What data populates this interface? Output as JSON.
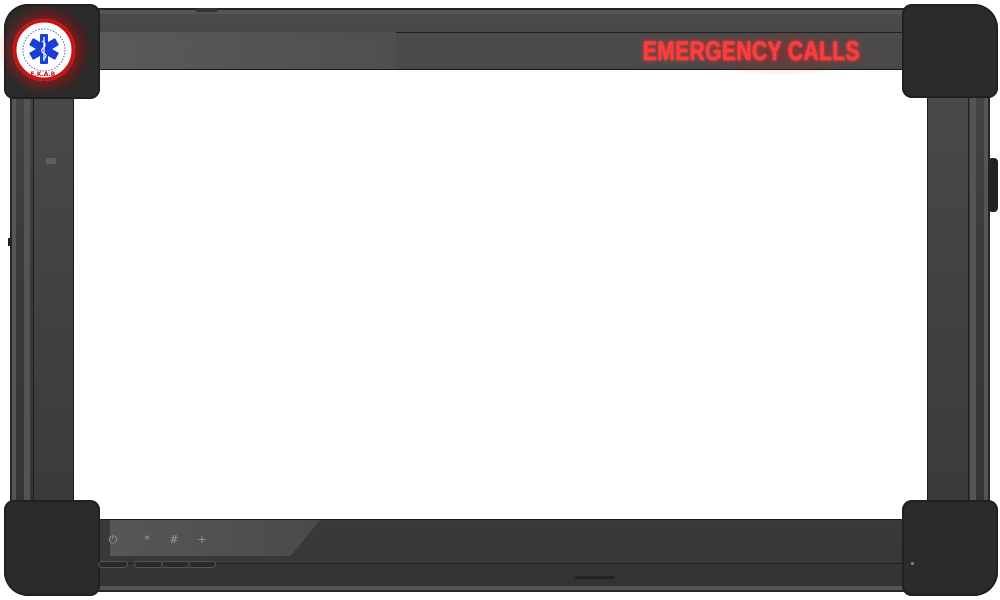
{
  "header": {
    "title": "EMERGENCY CALLS",
    "title_color": "#ff3b3b"
  },
  "logo": {
    "name": "ekab-star-of-life-logo",
    "ring_text": "ΕΘΝΙΚΟ ΚΕΝΤΡΟ ΑΜΕΣΗΣ ΒΟΗΘΕΙΑΣ",
    "bottom_text": "Ε.Κ.Α.Β.",
    "colors": {
      "star": "#1a3fd6",
      "ring": "#cc1111"
    }
  },
  "hardware_keys": {
    "power": "⏻",
    "star": "*",
    "hash": "#",
    "plus": "+"
  },
  "screen": {
    "background": "#ffffff"
  },
  "device": {
    "body_color": "#3a3a3a",
    "bumper_color": "#2b2b2b"
  }
}
